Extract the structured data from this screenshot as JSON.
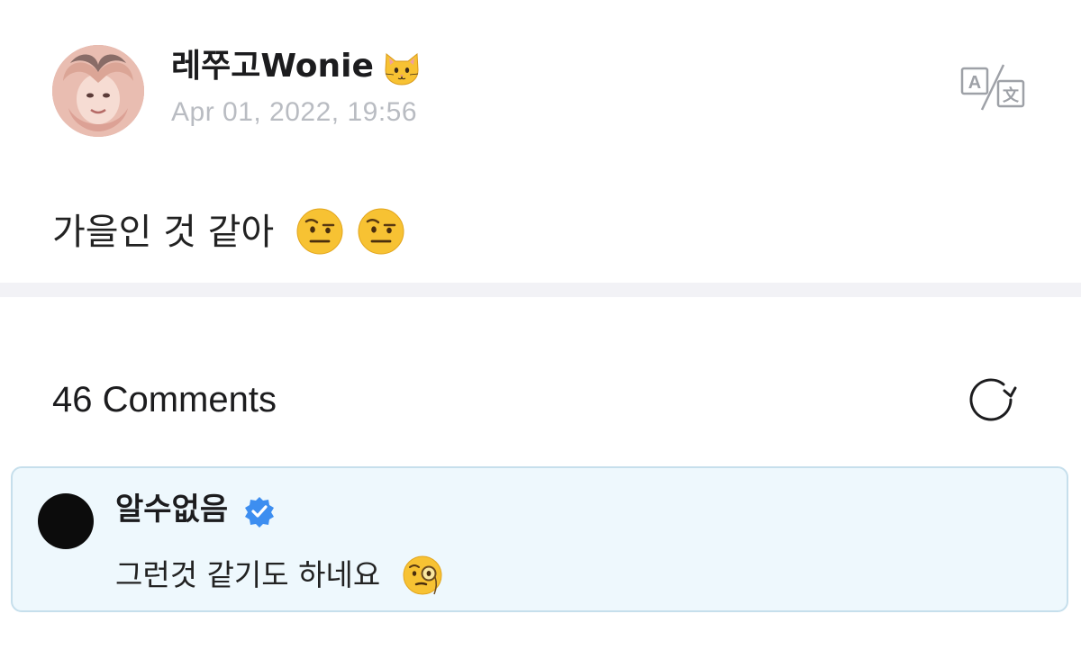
{
  "post": {
    "author_name": "레쭈고Wonie",
    "author_emoji": "cat-face-emoji",
    "date": "Apr 01, 2022, 19:56",
    "body_text": "가을인 것 같아",
    "body_emojis": [
      "face-with-raised-eyebrow-emoji",
      "face-with-raised-eyebrow-emoji"
    ],
    "translate_icon": "translate-icon"
  },
  "comments": {
    "title": "46 Comments",
    "refresh_icon": "refresh-icon",
    "items": [
      {
        "author": "알수없음",
        "verified": true,
        "text": "그런것 같기도 하네요",
        "emoji": "face-with-monocle-emoji"
      }
    ]
  },
  "colors": {
    "background": "#ffffff",
    "date_text": "#b9bcc2",
    "divider": "#f2f2f6",
    "comment_card_bg": "#eef8fd",
    "comment_card_border": "#c6dfec",
    "verified_badge": "#3d8ef0",
    "emoji_yellow": "#f7c233"
  }
}
